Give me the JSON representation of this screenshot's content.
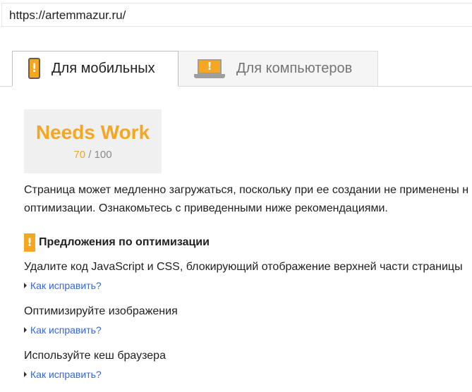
{
  "url_bar": {
    "value": "https://artemmazur.ru/"
  },
  "tabs": [
    {
      "label": "Для мобильных",
      "icon": "phone-warning-icon",
      "active": true
    },
    {
      "label": "Для компьютеров",
      "icon": "laptop-warning-icon",
      "active": false
    }
  ],
  "score": {
    "label": "Needs Work",
    "value": "70",
    "max": "/ 100",
    "color": "#f5a623"
  },
  "summary": {
    "line1": "Страница может медленно загружаться, поскольку при ее создании не применены н",
    "line2": "оптимизации. Ознакомьтесь с приведенными ниже рекомендациями."
  },
  "section": {
    "icon_glyph": "!",
    "title": "Предложения по оптимизации"
  },
  "suggestions": [
    {
      "title": "Удалите код JavaScript и CSS, блокирующий отображение верхней части страницы",
      "link": "Как исправить?"
    },
    {
      "title": "Оптимизируйте изображения",
      "link": "Как исправить?"
    },
    {
      "title": "Используйте кеш браузера",
      "link": "Как исправить?"
    }
  ],
  "colors": {
    "warning": "#f5a623",
    "link": "#3367d6"
  }
}
